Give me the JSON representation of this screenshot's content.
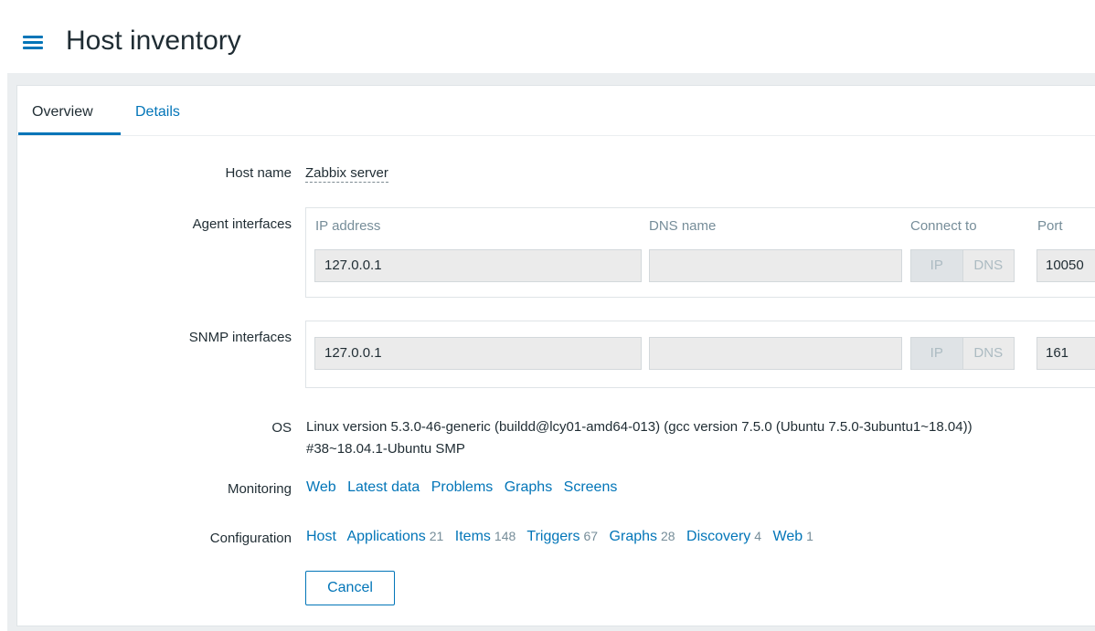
{
  "header": {
    "title": "Host inventory"
  },
  "tabs": [
    {
      "label": "Overview",
      "active": true
    },
    {
      "label": "Details",
      "active": false
    }
  ],
  "host": {
    "label": "Host name",
    "value": "Zabbix server"
  },
  "agent_interfaces": {
    "label": "Agent interfaces",
    "columns": {
      "ip": "IP address",
      "dns": "DNS name",
      "connect": "Connect to",
      "port": "Port"
    },
    "row": {
      "ip": "127.0.0.1",
      "dns": "",
      "connect_ip": "IP",
      "connect_dns": "DNS",
      "connect_selected": "IP",
      "port": "10050"
    }
  },
  "snmp_interfaces": {
    "label": "SNMP interfaces",
    "row": {
      "ip": "127.0.0.1",
      "dns": "",
      "connect_ip": "IP",
      "connect_dns": "DNS",
      "connect_selected": "IP",
      "port": "161"
    }
  },
  "os": {
    "label": "OS",
    "value": "Linux version 5.3.0-46-generic (buildd@lcy01-amd64-013) (gcc version 7.5.0 (Ubuntu 7.5.0-3ubuntu1~18.04)) #38~18.04.1-Ubuntu SMP"
  },
  "monitoring": {
    "label": "Monitoring",
    "links": [
      "Web",
      "Latest data",
      "Problems",
      "Graphs",
      "Screens"
    ]
  },
  "configuration": {
    "label": "Configuration",
    "links": [
      {
        "label": "Host",
        "count": ""
      },
      {
        "label": "Applications",
        "count": "21"
      },
      {
        "label": "Items",
        "count": "148"
      },
      {
        "label": "Triggers",
        "count": "67"
      },
      {
        "label": "Graphs",
        "count": "28"
      },
      {
        "label": "Discovery",
        "count": "4"
      },
      {
        "label": "Web",
        "count": "1"
      }
    ]
  },
  "actions": {
    "cancel_label": "Cancel"
  },
  "colors": {
    "accent": "#0275b8",
    "muted": "#768d99",
    "text": "#1f2c33",
    "field_bg": "#ebebeb"
  },
  "icons": {
    "menu": "hamburger-menu-icon"
  }
}
